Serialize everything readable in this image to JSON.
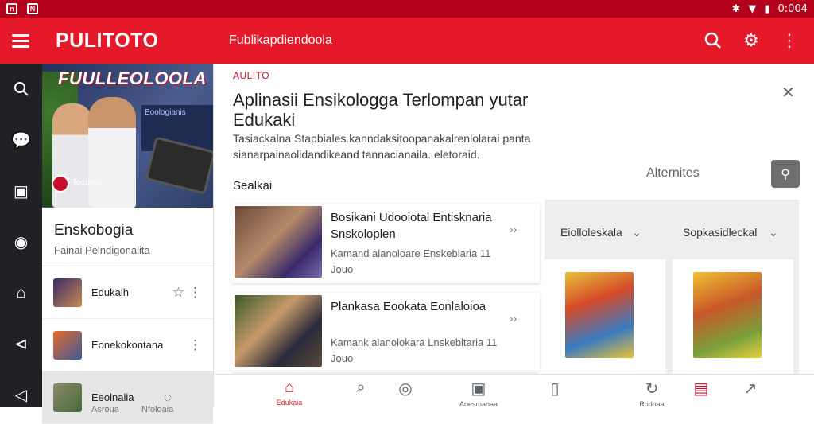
{
  "colors": {
    "statusbar": "#b3001b",
    "appbar": "#e5192a",
    "accent": "#e5192a",
    "rail": "#202124"
  },
  "statusbar": {
    "time": "0:004"
  },
  "appbar": {
    "brand": "PULITOTO",
    "title": "Fublikapdiendoola",
    "icons": [
      "menu-icon",
      "search-icon",
      "settings-icon",
      "more-vert-icon"
    ]
  },
  "rail": {
    "icons": [
      "search-icon",
      "chat-icon",
      "tablet-icon",
      "zoom-icon",
      "library-icon",
      "back-icon",
      "share-icon"
    ]
  },
  "library": {
    "hero_logo": "FUULLEOLOOLA",
    "hero_board": "Eoologianis",
    "hero_badge_text": "Teouoso",
    "title": "Enskobogia",
    "subtitle": "Fainai Pelndigonalita",
    "items": [
      {
        "label": "Edukaih"
      },
      {
        "label": "Eonekokontana"
      },
      {
        "label": "Eeolnalia",
        "sub1": "Asroua",
        "sub2": "Nfoloaia"
      }
    ]
  },
  "detail": {
    "tag": "AULITO",
    "title": "Aplinasii Ensikologga Terlompan yutar Edukaki",
    "description": "Tasiackalna Stapbiales.kanndaksitoopanakalrenlolarai panta sianarpainaolidandikeand tannacianaila. eletoraid.",
    "section_label": "Sealkai",
    "alternatives_label": "Alternites",
    "cards": [
      {
        "title": "Bosikani Udooiotal Entisknaria Snskoloplen",
        "subtitle": "Kamand alanoloare Enskeblaria 11 Jouo"
      },
      {
        "title": "Plankasa Eookata Eonlaloioa",
        "subtitle": "Kamank alanolokara Lnskebltaria 11 Jouo"
      }
    ],
    "filters": [
      {
        "label": "Eiolloleskala"
      },
      {
        "label": "Sopkasidleckal"
      }
    ]
  },
  "bottomnav": {
    "items": [
      {
        "label": "Edukaia",
        "icon": "home-icon"
      },
      {
        "label": "",
        "icon": "search-icon"
      },
      {
        "label": "",
        "icon": "location-icon"
      },
      {
        "label": "Aoesmanaa",
        "icon": "tablet-icon"
      },
      {
        "label": "",
        "icon": "bookmark-icon"
      },
      {
        "label": "Rodnaa",
        "icon": "refresh-icon"
      },
      {
        "label": "",
        "icon": "document-icon"
      },
      {
        "label": "",
        "icon": "open-icon"
      }
    ]
  }
}
